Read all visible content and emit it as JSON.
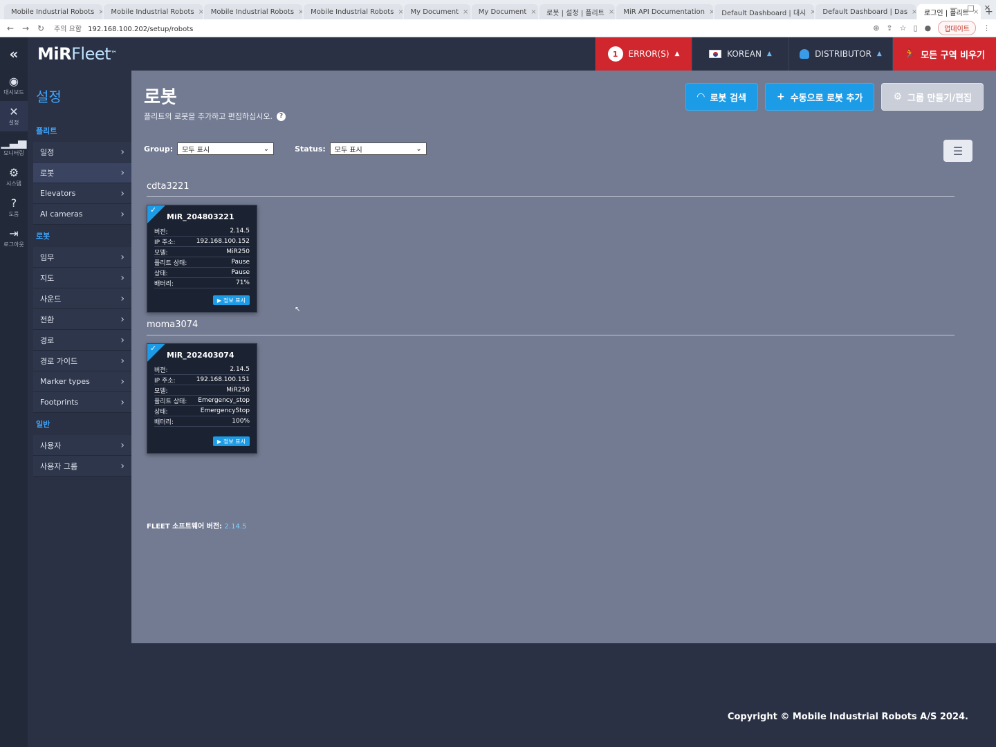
{
  "browser": {
    "tabs": [
      {
        "label": "Mobile Industrial Robots"
      },
      {
        "label": "Mobile Industrial Robots"
      },
      {
        "label": "Mobile Industrial Robots"
      },
      {
        "label": "Mobile Industrial Robots"
      },
      {
        "label": "My Document"
      },
      {
        "label": "My Document"
      },
      {
        "label": "로봇 | 설정 | 플리트"
      },
      {
        "label": "MiR API Documentation"
      },
      {
        "label": "Default Dashboard | 대시"
      },
      {
        "label": "Default Dashboard | Das"
      },
      {
        "label": "로그인 | 플리트",
        "active": true
      }
    ],
    "new_tab": "+",
    "url_security": "주의 요함",
    "url": "192.168.100.202/setup/robots",
    "update_label": "업데이트"
  },
  "header": {
    "collapse_icon": "«",
    "logo_mir": "MiR",
    "logo_fleet": "Fleet",
    "logo_tm": "™",
    "error_count": "1",
    "errors_label": "ERROR(S)",
    "language_label": "KOREAN",
    "user_label": "DISTRIBUTOR",
    "estop_label": "모든 구역 비우기"
  },
  "rail": [
    {
      "icon": "dashboard-icon",
      "glyph": "◉",
      "label": "대시보드"
    },
    {
      "icon": "wrench-icon",
      "glyph": "✕",
      "label": "설정",
      "active": true
    },
    {
      "icon": "chart-icon",
      "glyph": "▁▃▅",
      "label": "모니터링"
    },
    {
      "icon": "gear-icon",
      "glyph": "⚙",
      "label": "시스템"
    },
    {
      "icon": "help-icon",
      "glyph": "?",
      "label": "도움"
    },
    {
      "icon": "logout-icon",
      "glyph": "⇥",
      "label": "로그아웃"
    }
  ],
  "sidebar": {
    "title": "설정",
    "sections": [
      {
        "heading": "플리트",
        "items": [
          {
            "label": "일정",
            "chevron": true
          },
          {
            "label": "로봇",
            "chevron": true,
            "active": true
          },
          {
            "label": "Elevators",
            "chevron": true
          },
          {
            "label": "AI cameras",
            "chevron": true
          }
        ]
      },
      {
        "heading": "로봇",
        "items": [
          {
            "label": "임무",
            "chevron": true
          },
          {
            "label": "지도",
            "chevron": true
          },
          {
            "label": "사운드",
            "chevron": true
          },
          {
            "label": "전환",
            "chevron": true
          },
          {
            "label": "경로",
            "chevron": true
          },
          {
            "label": "경로 가이드",
            "chevron": true
          },
          {
            "label": "Marker types",
            "chevron": true
          },
          {
            "label": "Footprints",
            "chevron": true
          }
        ]
      },
      {
        "heading": "일반",
        "items": [
          {
            "label": "사용자",
            "chevron": true
          },
          {
            "label": "사용자 그룹",
            "chevron": true
          }
        ]
      }
    ]
  },
  "main": {
    "title": "로봇",
    "subtitle": "플리트의 로봇을 추가하고 편집하십시오.",
    "actions": {
      "scan": "로봇 검색",
      "add": "수동으로 로봇 추가",
      "group": "그룹 만들기/편집"
    },
    "filters": {
      "group_label": "Group:",
      "group_value": "모두 표시",
      "status_label": "Status:",
      "status_value": "모두 표시"
    },
    "groups": [
      {
        "name": "cdta3221",
        "robot": {
          "name": "MiR_204803221",
          "rows": [
            {
              "k": "버전:",
              "v": "2.14.5"
            },
            {
              "k": "IP 주소:",
              "v": "192.168.100.152"
            },
            {
              "k": "모델:",
              "v": "MiR250"
            },
            {
              "k": "플리트 상태:",
              "v": "Pause"
            },
            {
              "k": "상태:",
              "v": "Pause"
            },
            {
              "k": "배터리:",
              "v": "71%"
            }
          ],
          "button": "정보 표시"
        }
      },
      {
        "name": "moma3074",
        "robot": {
          "name": "MiR_202403074",
          "rows": [
            {
              "k": "버전:",
              "v": "2.14.5"
            },
            {
              "k": "IP 주소:",
              "v": "192.168.100.151"
            },
            {
              "k": "모델:",
              "v": "MiR250"
            },
            {
              "k": "플리트 상태:",
              "v": "Emergency_stop"
            },
            {
              "k": "상태:",
              "v": "EmergencyStop"
            },
            {
              "k": "배터리:",
              "v": "100%"
            }
          ],
          "button": "정보 표시"
        }
      }
    ],
    "fleet_version_label": "FLEET 소프트웨어 버전:",
    "fleet_version": "2.14.5"
  },
  "footer": {
    "copyright": "Copyright © Mobile Industrial Robots A/S 2024."
  },
  "colors": {
    "accent": "#1c9be6",
    "error": "#d0262d",
    "header_bg": "#2a3144",
    "content_bg": "#737b92"
  }
}
